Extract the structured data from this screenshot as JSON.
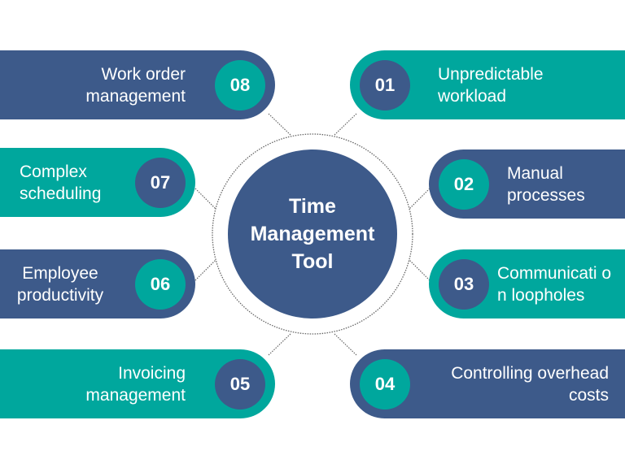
{
  "colors": {
    "navy": "#3d5a8a",
    "teal": "#00a79d",
    "background": "#ffffff",
    "text": "#ffffff",
    "connector": "#666666"
  },
  "center": {
    "title": "Time\nManagement\nTool"
  },
  "items": [
    {
      "number": "01",
      "label": "Unpredictable workload"
    },
    {
      "number": "02",
      "label": "Manual processes"
    },
    {
      "number": "03",
      "label": "Communicati on loopholes"
    },
    {
      "number": "04",
      "label": "Controlling overhead costs"
    },
    {
      "number": "05",
      "label": "Invoicing management"
    },
    {
      "number": "06",
      "label": "Employee productivity"
    },
    {
      "number": "07",
      "label": "Complex scheduling"
    },
    {
      "number": "08",
      "label": "Work order management"
    }
  ]
}
